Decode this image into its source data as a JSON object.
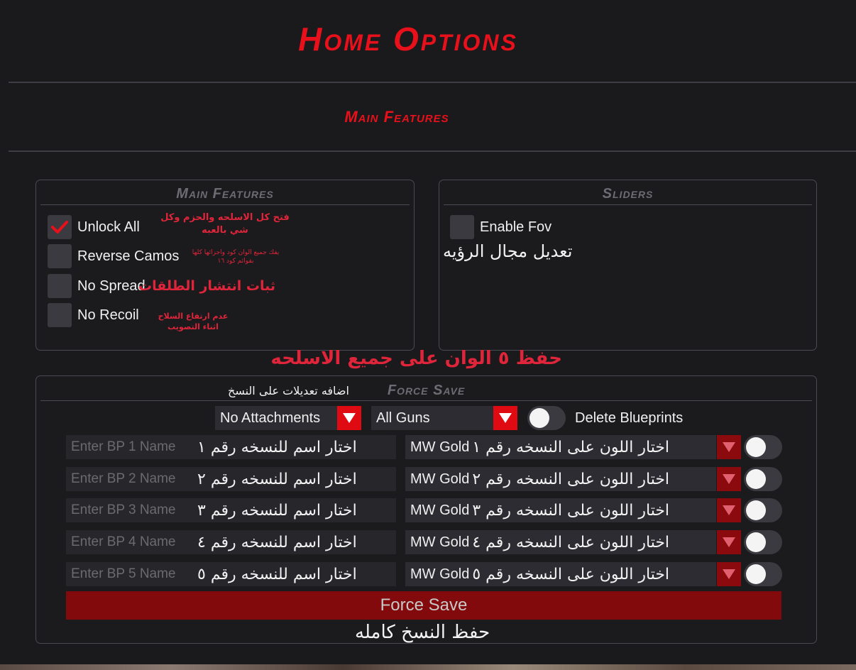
{
  "header": {
    "title": "Home Options",
    "subtitle": "Main Features"
  },
  "main_features": {
    "title": "Main Features",
    "items": [
      {
        "label": "Unlock All",
        "checked": true,
        "note": "فتح كل الاسلحه والحزم وكل شي بالعبه"
      },
      {
        "label": "Reverse Camos",
        "checked": false,
        "note": "يفك جميع الوان كود واجزائها كلها بقوائم كود ١٦"
      },
      {
        "label": "No Spread",
        "checked": false,
        "note": "ثبات انتشار الطلقات"
      },
      {
        "label": "No Recoil",
        "checked": false,
        "note": "عدم ارتفاع السلاح اثناء التصويب"
      }
    ]
  },
  "sliders": {
    "title": "Sliders",
    "enable_fov_label": "Enable Fov",
    "enable_fov_checked": false,
    "fov_note": "تعديل مجال الرؤيه"
  },
  "save_colors_note": "حفظ ٥ الوان على جميع الاسلحه",
  "force_save": {
    "title": "Force Save",
    "title_note": "اضافه تعديلات على النسخ",
    "attachments_select": "No Attachments",
    "guns_select": "All Guns",
    "delete_blueprints_label": "Delete Blueprints",
    "blueprints": [
      {
        "placeholder": "Enter BP 1 Name",
        "name_note": "اختار اسم للنسخه رقم ١",
        "color": "MW Gold",
        "color_note": "اختار اللون على النسخه رقم ١"
      },
      {
        "placeholder": "Enter BP 2 Name",
        "name_note": "اختار اسم للنسخه رقم ٢",
        "color": "MW Gold",
        "color_note": "اختار اللون على النسخه رقم ٢"
      },
      {
        "placeholder": "Enter BP 3 Name",
        "name_note": "اختار اسم للنسخه رقم ٣",
        "color": "MW Gold",
        "color_note": "اختار اللون على النسخه رقم ٣"
      },
      {
        "placeholder": "Enter BP 4 Name",
        "name_note": "اختار اسم للنسخه رقم ٤",
        "color": "MW Gold",
        "color_note": "اختار اللون على النسخه رقم ٤"
      },
      {
        "placeholder": "Enter BP 5 Name",
        "name_note": "اختار اسم للنسخه رقم ٥",
        "color": "MW Gold",
        "color_note": "اختار اللون على النسخه رقم ٥"
      }
    ],
    "button_label": "Force Save",
    "button_note": "حفظ النسخ كامله"
  },
  "colors": {
    "accent": "#e8101a",
    "dropdown_dark": "#8a0a0e",
    "button": "#830a0c"
  },
  "icons": {
    "check": "check-icon",
    "dropdown": "triangle-down-icon"
  }
}
